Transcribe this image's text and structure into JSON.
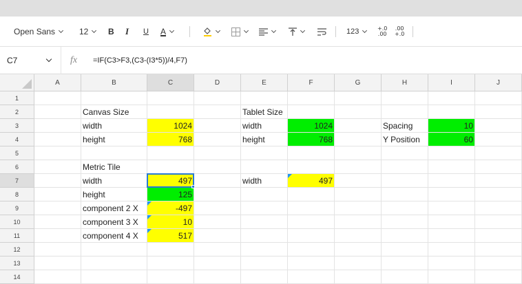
{
  "toolbar": {
    "font_family": "Open Sans",
    "font_size": "12",
    "bold_label": "B",
    "italic_label": "I",
    "underline_label": "U",
    "font_color_label": "A",
    "number_format_label": "123",
    "decrease_decimal_label": "+.0\n.00",
    "increase_decimal_label": ".00\n+.0"
  },
  "formula_bar": {
    "cell_ref": "C7",
    "fx_label": "fx",
    "formula": "=IF(C3>F3,(C3-(I3*5))/4,F7)"
  },
  "columns": [
    "A",
    "B",
    "C",
    "D",
    "E",
    "F",
    "G",
    "H",
    "I",
    "J"
  ],
  "rows": [
    "1",
    "2",
    "3",
    "4",
    "5",
    "6",
    "7",
    "8",
    "9",
    "10",
    "11",
    "12",
    "13",
    "14"
  ],
  "cells": {
    "B2": "Canvas Size",
    "B3": "width",
    "C3": "1024",
    "B4": "height",
    "C4": "768",
    "B6": "Metric Tile",
    "B7": "width",
    "C7": "497",
    "B8": "height",
    "C8": "125",
    "B9": "component 2 X",
    "C9": "-497",
    "B10": "component 3 X",
    "C10": "10",
    "B11": "component 4 X",
    "C11": "517",
    "E2": "Tablet Size",
    "E3": "width",
    "F3": "1024",
    "E4": "height",
    "F4": "768",
    "E7": "width",
    "F7": "497",
    "H3": "Spacing",
    "I3": "10",
    "H4": "Y Position",
    "I4": "60"
  },
  "colors": {
    "yellow": "#ffff00",
    "green": "#00ee00",
    "selection": "#2a7ad4",
    "comment_marker": "#2196f3"
  }
}
